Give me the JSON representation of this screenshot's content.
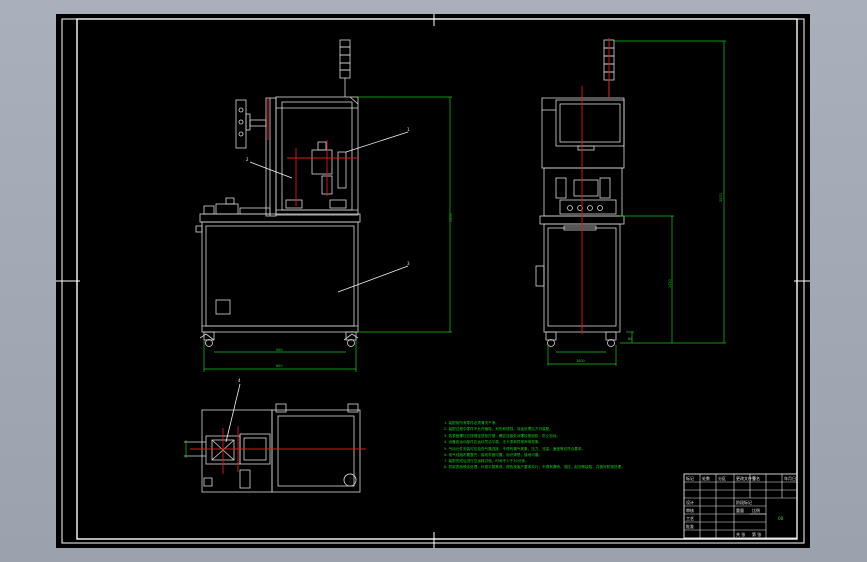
{
  "colors": {
    "sheet": "#000000",
    "frame": "#ffffff",
    "dimension": "#17c817",
    "centerline": "#e01818",
    "part": "#d8d8d8"
  },
  "front_view": {
    "balloons": [
      "1",
      "2",
      "3"
    ],
    "dims": {
      "width": "800",
      "inner": "000",
      "height": "1500"
    }
  },
  "side_view": {
    "dims": {
      "total_height": "2000",
      "cabinet_height": "1050",
      "base": "60",
      "width": "1000"
    }
  },
  "top_view": {
    "balloons": [
      "4"
    ]
  },
  "notes": [
    "1. 装配前所有零件必须清洗干净。",
    "2. 装配过程中零件不允许磕碰、划伤和锈蚀，涂油处理后方可装配。",
    "3. 各紧固螺钉应按规定扭矩拧紧，螺纹连接处涂螺纹紧固胶，防止松动。",
    "4. 设备各运动部件应运动灵活平稳，无卡滞和异常声响现象。",
    "5. 气动元件安装时应检查气路连接，不得有漏气现象，压力、流量、速度等应符合要求。",
    "6. 电气线路布置整齐，接线牢固可靠，标识清楚，接地可靠。",
    "7. 装配完成后进行空运转试验，时间不少于30分钟。",
    "8. 机架表面喷涂处理，外观平整美观，颜色按客户要求执行，不得有漏喷、流挂、起泡等缺陷，并做好防锈处理。"
  ],
  "title_block": {
    "header": [
      "标记",
      "处数",
      "分区",
      "更改文件号",
      "签名",
      "年月日"
    ],
    "rows": [
      "设计",
      "审核",
      "工艺",
      "批准"
    ],
    "stage": [
      "阶段标记",
      "重量",
      "比例"
    ],
    "footer": [
      "共 张",
      "第 张"
    ],
    "code": "00"
  }
}
